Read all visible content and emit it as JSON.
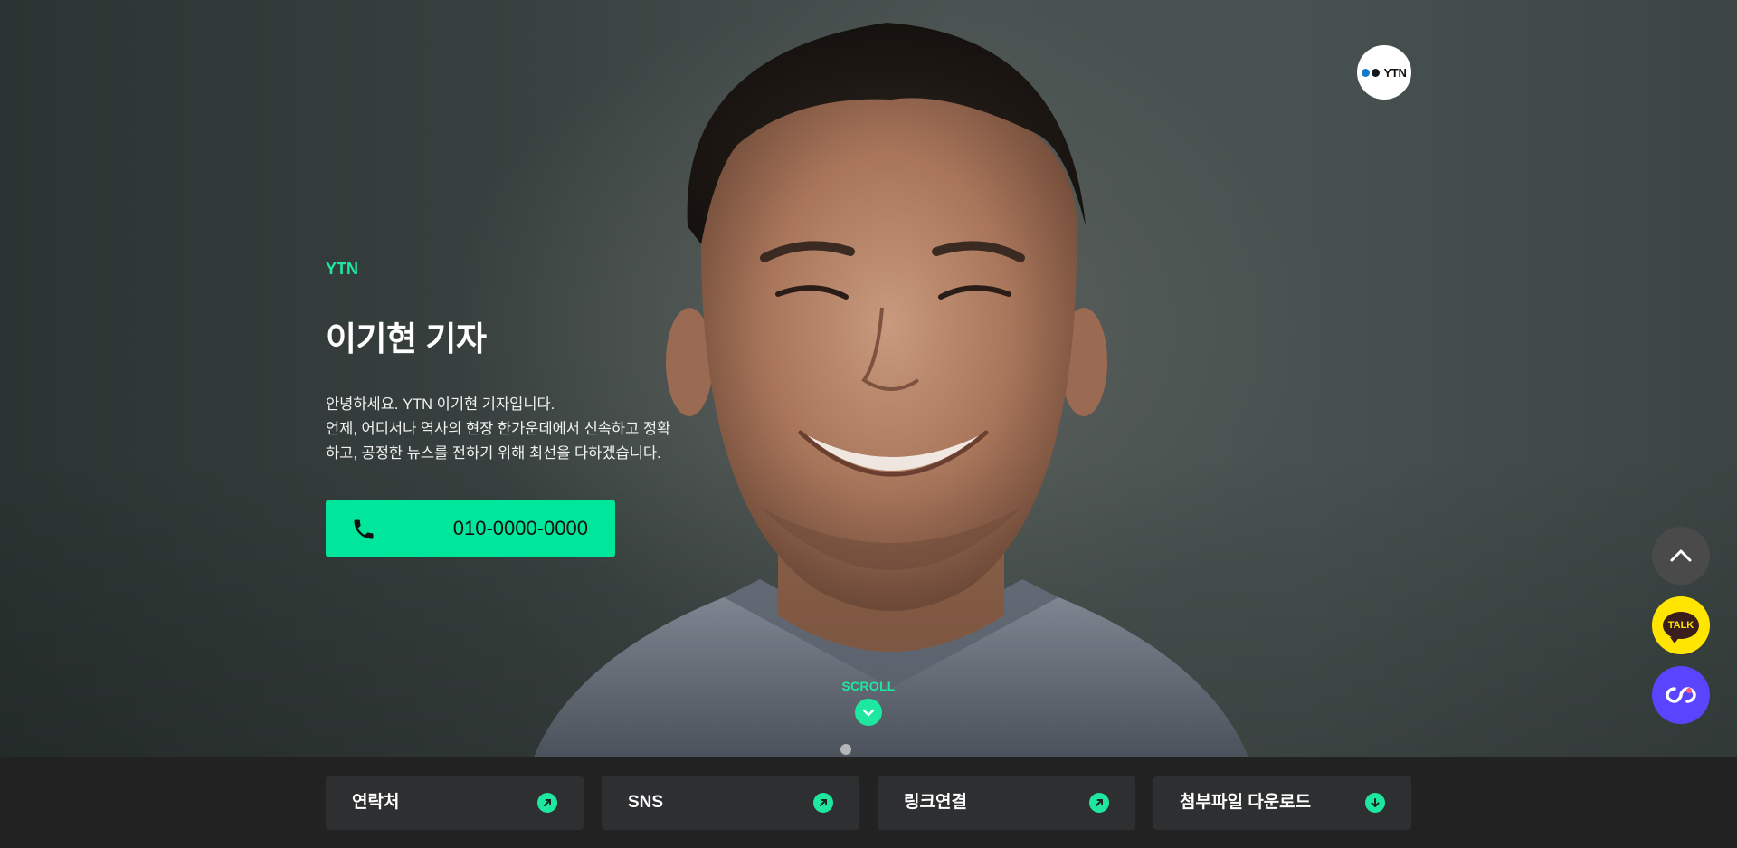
{
  "brand": {
    "logo_text": "YTN"
  },
  "profile": {
    "organization": "YTN",
    "name": "이기현 기자",
    "description_lines": [
      "안녕하세요. YTN 이기현 기자입니다.",
      "언제, 어디서나 역사의 현장 한가운데에서 신속하고 정확",
      "하고, 공정한 뉴스를 전하기 위해 최선을 다하겠습니다."
    ],
    "phone": "010-0000-0000"
  },
  "scroll": {
    "label": "SCROLL"
  },
  "floating": {
    "talk_label": "TALK"
  },
  "bottom_nav": {
    "items": [
      {
        "label": "연락처",
        "icon": "arrow-up-right-icon"
      },
      {
        "label": "SNS",
        "icon": "arrow-up-right-icon"
      },
      {
        "label": "링크연결",
        "icon": "arrow-up-right-icon"
      },
      {
        "label": "첨부파일 다운로드",
        "icon": "arrow-down-icon"
      }
    ]
  },
  "colors": {
    "accent": "#00e69a",
    "kakao": "#ffe500",
    "app": "#5a45ff",
    "bar": "#222222"
  }
}
